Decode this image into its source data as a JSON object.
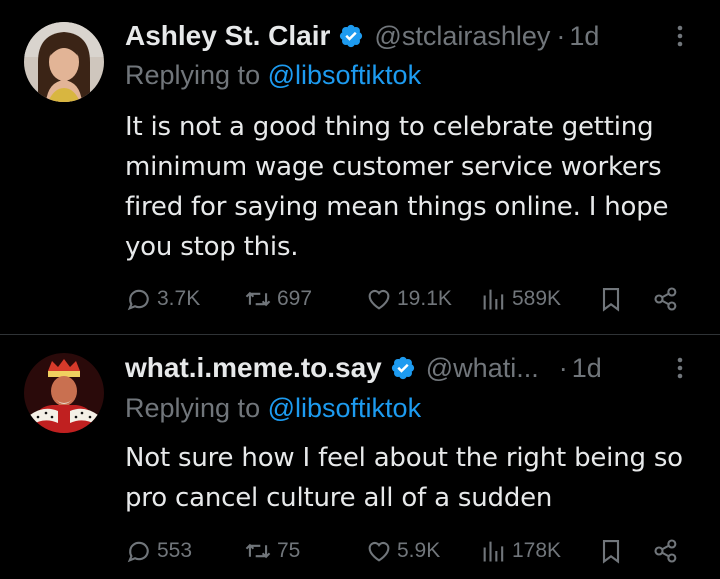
{
  "tweets": [
    {
      "display_name": "Ashley St. Clair",
      "handle": "@stclairashley",
      "separator": "·",
      "time": "1d",
      "replying_prefix": "Replying to",
      "replying_to": "@libsoftiktok",
      "text": "It is not a good thing to celebrate getting minimum wage customer service workers fired for saying mean things online. I hope you stop this.",
      "replies": "3.7K",
      "reposts": "697",
      "likes": "19.1K",
      "views": "589K"
    },
    {
      "display_name": "what.i.meme.to.say",
      "handle": "@whati...",
      "separator": "·",
      "time": "1d",
      "replying_prefix": "Replying to",
      "replying_to": "@libsoftiktok",
      "text": "Not sure how I feel about the right being so pro cancel culture all of a sudden",
      "replies": "553",
      "reposts": "75",
      "likes": "5.9K",
      "views": "178K"
    }
  ],
  "colors": {
    "background": "#000000",
    "text_primary": "#e7e9ea",
    "text_secondary": "#71767b",
    "link": "#1d9bf0",
    "verified": "#1d9bf0",
    "divider": "#2f3336"
  },
  "icons": [
    "verified-badge-icon",
    "more-icon",
    "reply-icon",
    "repost-icon",
    "like-icon",
    "views-icon",
    "bookmark-icon",
    "share-icon"
  ]
}
